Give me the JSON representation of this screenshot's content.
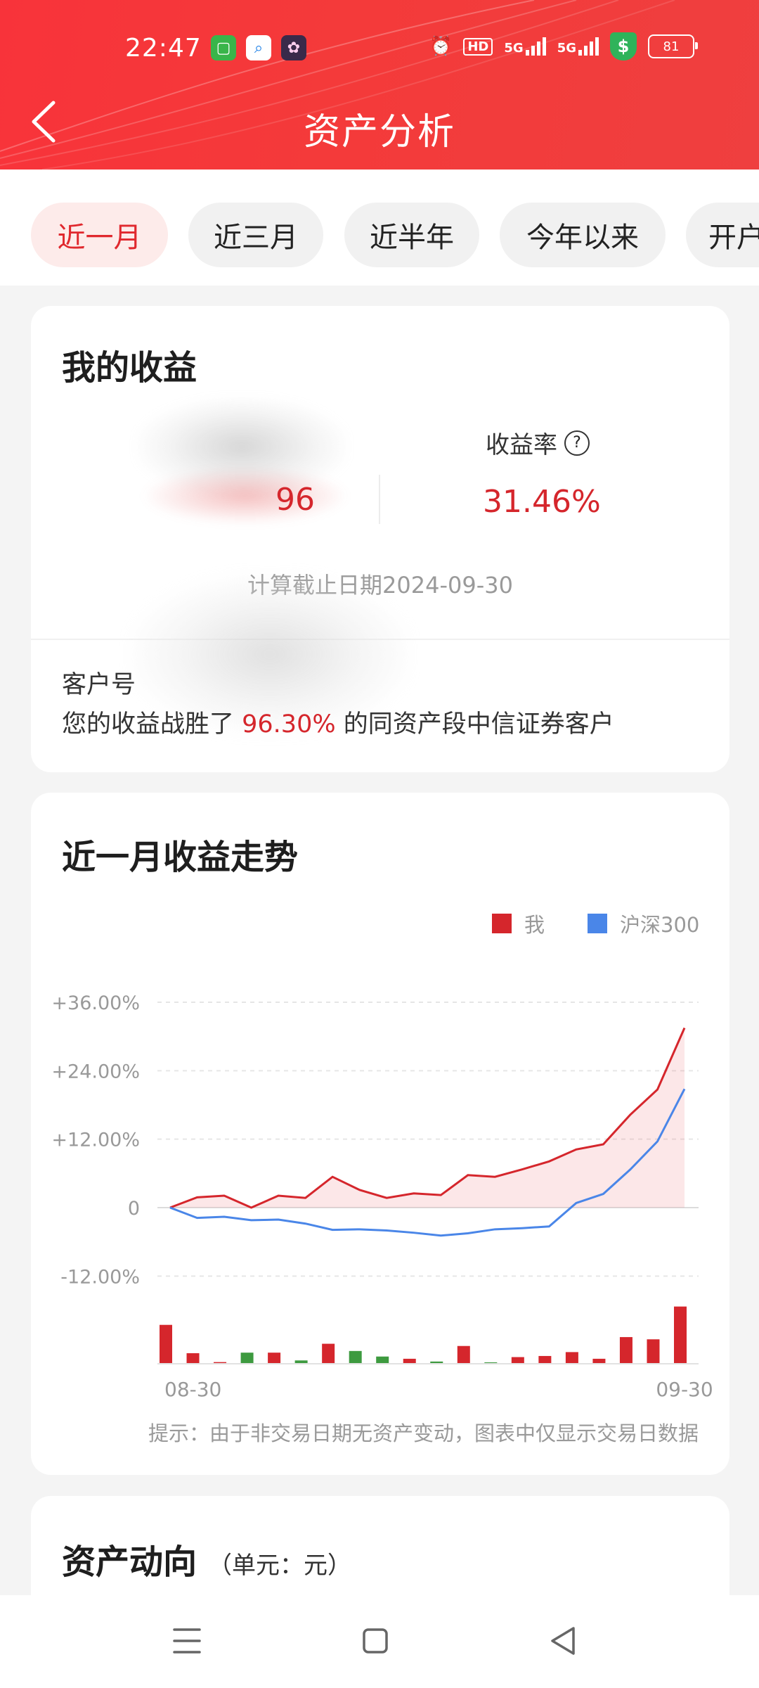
{
  "status_bar": {
    "time": "22:47",
    "battery": "81",
    "hd_label": "HD",
    "net1": "5G",
    "net2": "5G"
  },
  "header": {
    "title": "资产分析"
  },
  "tabs": [
    {
      "label": "近一月",
      "active": true
    },
    {
      "label": "近三月",
      "active": false
    },
    {
      "label": "近半年",
      "active": false
    },
    {
      "label": "今年以来",
      "active": false
    },
    {
      "label": "开户",
      "active": false
    }
  ],
  "earnings_card": {
    "title": "我的收益",
    "rate_label": "收益率",
    "rate_value": "31.46%",
    "amount_partial": "96",
    "date_note": "计算截止日期2024-09-30",
    "customer_label": "客户号",
    "beat_prefix": "您的收益战胜了 ",
    "beat_value": "96.30%",
    "beat_suffix": " 的同资产段中信证券客户"
  },
  "trend_card": {
    "title": "近一月收益走势",
    "hint": "提示：由于非交易日期无资产变动，图表中仅显示交易日数据"
  },
  "chart_data": {
    "type": "line",
    "x_start_label": "08-30",
    "x_end_label": "09-30",
    "yticks": [
      "+36.00%",
      "+24.00%",
      "+12.00%",
      "0",
      "-12.00%"
    ],
    "ylim": [
      -12,
      36
    ],
    "grid": true,
    "legend_position": "top-right",
    "series": [
      {
        "name": "我",
        "color": "#d5262c",
        "values": [
          0,
          1.8,
          2.1,
          0,
          2.1,
          1.7,
          5.4,
          3.1,
          1.7,
          2.5,
          2.2,
          5.7,
          5.4,
          6.7,
          8.1,
          10.2,
          11.1,
          16.3,
          20.7,
          31.5
        ]
      },
      {
        "name": "沪深300",
        "color": "#4a86e8",
        "values": [
          0,
          -1.8,
          -1.6,
          -2.2,
          -2.1,
          -2.8,
          -3.9,
          -3.8,
          -4.0,
          -4.4,
          -4.9,
          -4.5,
          -3.8,
          -3.6,
          -3.3,
          0.8,
          2.4,
          6.7,
          11.6,
          20.8
        ]
      }
    ],
    "bars": {
      "values": [
        7,
        1.9,
        0.3,
        2.0,
        2.0,
        0.6,
        3.6,
        2.3,
        1.3,
        0.9,
        0.4,
        3.2,
        0.2,
        1.2,
        1.4,
        2.1,
        0.9,
        4.8,
        4.4,
        10.3
      ],
      "colors": [
        "r",
        "r",
        "r",
        "g",
        "r",
        "g",
        "r",
        "g",
        "g",
        "r",
        "g",
        "r",
        "g",
        "r",
        "r",
        "r",
        "r",
        "r",
        "r",
        "r"
      ],
      "red": "#d5262c",
      "green": "#3d9a3f"
    }
  },
  "assets_card": {
    "title": "资产动向",
    "unit": "（单元：元）"
  }
}
